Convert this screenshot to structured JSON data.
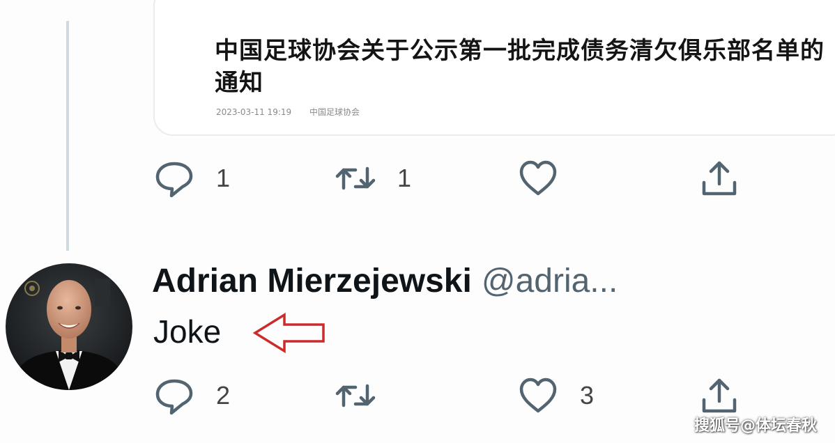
{
  "quoted_card": {
    "title": "中国足球协会关于公示第一批完成债务清欠俱乐部名单的通知",
    "date": "2023-03-11 19:19",
    "source": "中国足球协会"
  },
  "first_tweet": {
    "reply_count": "1",
    "retweet_count": "1",
    "like_count": "",
    "share_icon": "share-icon"
  },
  "reply_tweet": {
    "author_name": "Adrian Mierzejewski",
    "author_handle": "@adria...",
    "text": "Joke",
    "reply_count": "2",
    "retweet_count": "",
    "like_count": "3"
  },
  "annotation": {
    "arrow_color": "#cc2b2b"
  },
  "colors": {
    "icon": "#536471",
    "thread_line": "#cfd9de",
    "card_border": "#e6ecf0"
  },
  "watermark": "搜狐号@体坛春秋"
}
